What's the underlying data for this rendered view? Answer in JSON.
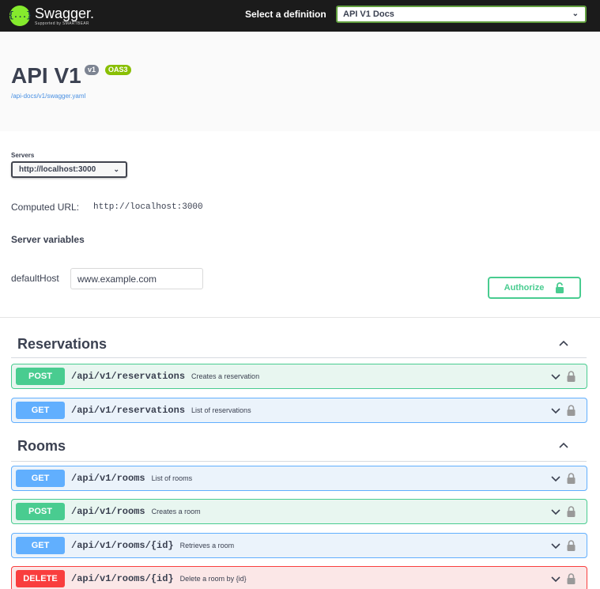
{
  "topbar": {
    "logo_icon_text": "{...}",
    "logo_name": "Swagger.",
    "logo_sub": "Supported by SMARTBEAR",
    "definition_label": "Select a definition",
    "definition_value": "API V1 Docs"
  },
  "info": {
    "title": "API V1",
    "version_badge": "v1",
    "oas_badge": "OAS3",
    "spec_link": "/api-docs/v1/swagger.yaml"
  },
  "servers": {
    "label": "Servers",
    "selected": "http://localhost:3000",
    "computed_label": "Computed URL:",
    "computed_url": "http://localhost:3000",
    "variables_heading": "Server variables",
    "default_host_label": "defaultHost",
    "default_host_value": "www.example.com"
  },
  "authorize": {
    "label": "Authorize"
  },
  "groups": [
    {
      "name": "Reservations",
      "operations": [
        {
          "method": "POST",
          "path": "/api/v1/reservations",
          "summary": "Creates a reservation"
        },
        {
          "method": "GET",
          "path": "/api/v1/reservations",
          "summary": "List of reservations"
        }
      ]
    },
    {
      "name": "Rooms",
      "operations": [
        {
          "method": "GET",
          "path": "/api/v1/rooms",
          "summary": "List of rooms"
        },
        {
          "method": "POST",
          "path": "/api/v1/rooms",
          "summary": "Creates a room"
        },
        {
          "method": "GET",
          "path": "/api/v1/rooms/{id}",
          "summary": "Retrieves a room"
        },
        {
          "method": "DELETE",
          "path": "/api/v1/rooms/{id}",
          "summary": "Delete a room by {id}"
        }
      ]
    }
  ],
  "colors": {
    "post": "#49cc90",
    "get": "#61affe",
    "delete": "#f93e3e",
    "topbar": "#1b1b1b",
    "brand": "#85ea2d"
  },
  "icons": {
    "expand": "chevron-down-icon",
    "collapse": "chevron-up-icon",
    "lock": "lock-icon"
  }
}
